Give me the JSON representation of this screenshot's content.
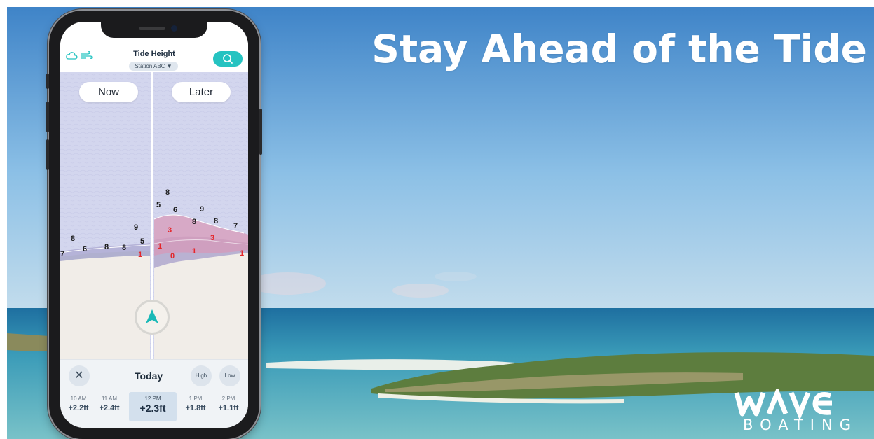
{
  "headline": "Stay Ahead of the Tide",
  "brand": {
    "name": "wave",
    "sub": "BOATING"
  },
  "app": {
    "title": "Tide Height",
    "station": "Station ABC",
    "station_caret": "▼",
    "icons": [
      "cloud-icon",
      "wind-icon",
      "search-icon"
    ],
    "compare": {
      "now_label": "Now",
      "later_label": "Later"
    },
    "depths_now": [
      "8",
      "7",
      "6",
      "8",
      "8",
      "9",
      "5",
      "1"
    ],
    "depths_later": [
      "8",
      "5",
      "6",
      "9",
      "8",
      "8",
      "7",
      "3",
      "3",
      "1",
      "0",
      "1",
      "1"
    ],
    "bottom": {
      "close_glyph": "✕",
      "day": "Today",
      "high_label": "High",
      "low_label": "Low",
      "slots": [
        {
          "time": "10 AM",
          "value": "+2.2ft"
        },
        {
          "time": "11 AM",
          "value": "+2.4ft"
        },
        {
          "time": "12 PM",
          "value": "+2.3ft"
        },
        {
          "time": "1 PM",
          "value": "+1.8ft"
        },
        {
          "time": "2 PM",
          "value": "+1.1ft"
        }
      ],
      "selected_index": 2
    }
  },
  "colors": {
    "accent": "#25c3c1",
    "sky_top": "#3f86c9",
    "sea": "#3aa0b4",
    "depth_red": "#e5262a"
  }
}
